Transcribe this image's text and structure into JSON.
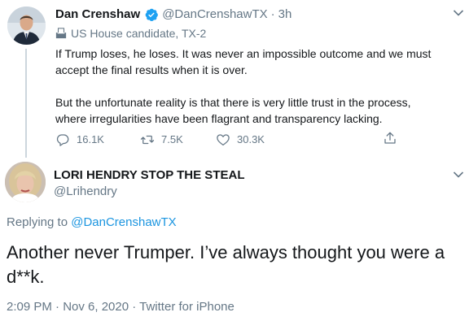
{
  "parent_tweet": {
    "display_name": "Dan Crenshaw",
    "handle": "@DanCrenshawTX",
    "separator": "·",
    "time_ago": "3h",
    "label": "US House candidate, TX-2",
    "body_paragraphs": [
      "If Trump loses, he loses. It was never an impossible outcome and we must",
      "accept the final results when it is over.",
      "But the unfortunate reality is that there is very little trust in the process,",
      "where irregularities have been flagrant and transparency lacking."
    ],
    "actions": {
      "reply_count": "16.1K",
      "retweet_count": "7.5K",
      "like_count": "30.3K"
    },
    "icons": [
      "verified-badge-icon",
      "ballot-box-icon",
      "reply-icon",
      "retweet-icon",
      "like-icon",
      "share-icon",
      "chevron-down-icon"
    ]
  },
  "reply_tweet": {
    "display_name": "LORI HENDRY STOP THE STEAL",
    "handle": "@Lrihendry",
    "replying_to_prefix": "Replying to",
    "replying_to_handle": "@DanCrenshawTX",
    "body": "Another never Trumper. I’ve always thought you were a d**k.",
    "timestamp": "2:09 PM · Nov 6, 2020 · Twitter for iPhone"
  },
  "colors": {
    "verified": "#1da1f2",
    "link": "#1b95e0",
    "secondary_text": "#657786",
    "primary_text": "#14171a",
    "thread_line": "#ccd6dd"
  }
}
